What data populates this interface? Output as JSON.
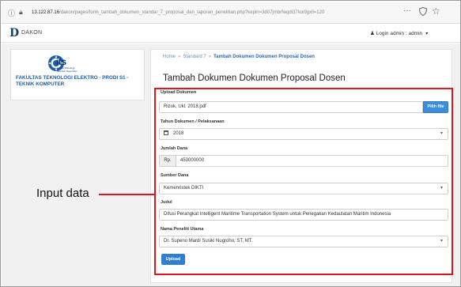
{
  "browser": {
    "url_host": "13.122.87.16",
    "url_path": "/dakon/pages/form_tambah_dokumen_standar_7_proposal_dan_laporan_penelitian.php?kepin=3d07jmbrfwqdi37koi9gxll=120",
    "menu_glyph": "···"
  },
  "app": {
    "logo_letter": "D",
    "name": "DAKON",
    "login_text": "Login admin : admin"
  },
  "sidebar": {
    "its_logo_text": "its",
    "its_subtitle": "Institut Teknologi Sepuluh Nopember",
    "faculty": "FAKULTAS TEKNOLOGI ELEKTRO - PRODI S1 - TEKNIK KOMPUTER"
  },
  "breadcrumb": {
    "home": "Home",
    "sep": "»",
    "standard": "Standard 7",
    "current": "Tambah Dokumen Dokumen Proposal Dosen"
  },
  "page_title": "Tambah Dokumen Dokumen Proposal Dosen",
  "form": {
    "upload": {
      "label": "Upload Dokumen",
      "value": "Rizok, Ukl. 2018.pdf",
      "browse_label": "Pilih file"
    },
    "year": {
      "label": "Tahun Dokumen / Pelaksanaan",
      "value": "2018"
    },
    "amount": {
      "label": "Jumlah Dana",
      "prefix": "Rp.",
      "value": "453000000"
    },
    "source": {
      "label": "Sumber Dana",
      "value": "Kemenristek DIKTI"
    },
    "title": {
      "label": "Judul",
      "value": "Difusi Perangkat Intelligent Maritime Transportation System untuk Penegakan Kedaulatan Maritim Indonesia"
    },
    "researcher": {
      "label": "Nama Peneliti Utama",
      "value": "Dr. Supeno Mardi Susiki Nugroho, ST, MT."
    },
    "submit_label": "Upload"
  },
  "annotation": {
    "label": "Input data",
    "color": "#e0141e"
  },
  "colors": {
    "accent": "#2e7fd0",
    "link": "#2b67b1",
    "brand": "#17406d"
  }
}
